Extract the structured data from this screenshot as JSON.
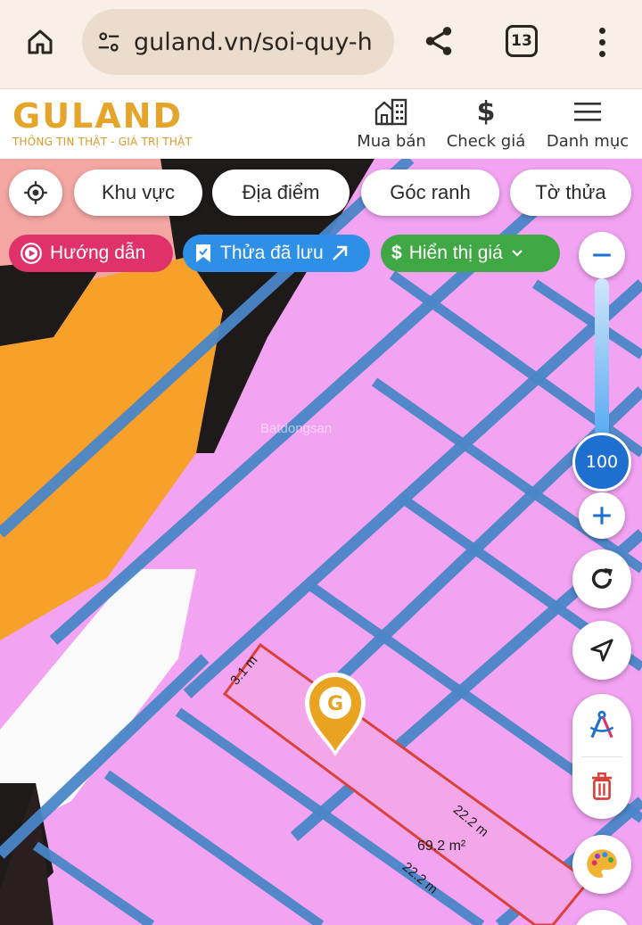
{
  "browser": {
    "url": "guland.vn/soi-quy-h",
    "tab_count": "13"
  },
  "header": {
    "brand": "GULAND",
    "tagline": "THÔNG TIN THẬT - GIÁ TRỊ THẬT",
    "nav": {
      "buy_sell": "Mua bán",
      "check_price": "Check giá",
      "menu": "Danh mục"
    }
  },
  "filters": {
    "area": "Khu vực",
    "location": "Địa điểm",
    "corner": "Góc ranh",
    "parcel": "Tờ thửa"
  },
  "actions": {
    "guide": "Hướng dẫn",
    "saved": "Thửa đã lưu",
    "price": "Hiển thị giá"
  },
  "zoom": {
    "value": "100"
  },
  "map": {
    "watermark": "Batdongsan",
    "width_label": "3.1 m",
    "length_label_1": "22.2 m",
    "length_label_2": "22.2 m",
    "area_label": "69.2 m²"
  },
  "colors": {
    "residential": "#f2a3f2",
    "commercial": "#f7a02a",
    "road": "#4a86c8",
    "guide": "#e0326a",
    "saved": "#2e8fe6",
    "price": "#3fa743",
    "zoom": "#1f6fd1",
    "brand": "#e4a52a"
  }
}
